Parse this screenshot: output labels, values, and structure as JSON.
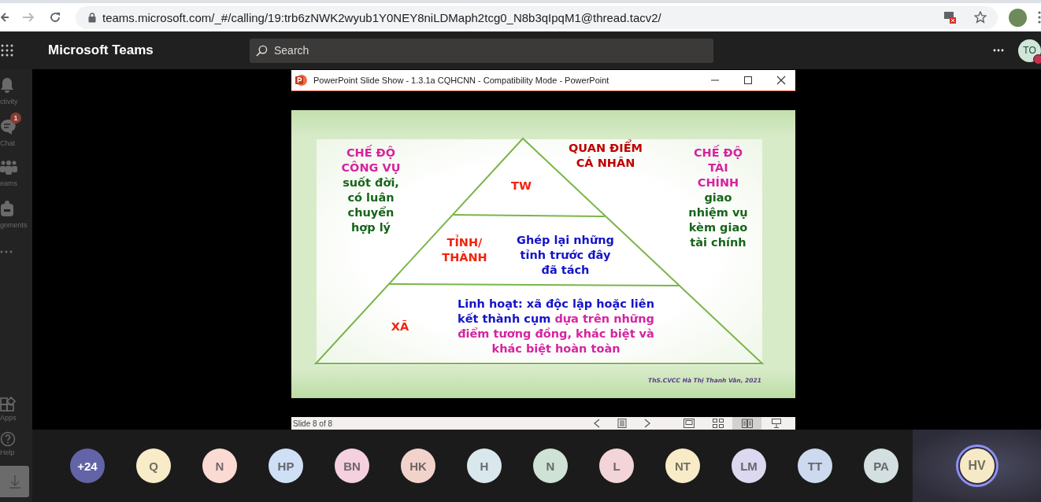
{
  "browser": {
    "url": "teams.microsoft.com/_#/calling/19:trb6zNWK2wyub1Y0NEY8niLDMaph2tcg0_N8b3qIpqM1@thread.tacv2/"
  },
  "app": {
    "title": "Microsoft Teams",
    "search_placeholder": "Search",
    "user_initials": "TO",
    "busy": true
  },
  "rail": {
    "top": [
      {
        "kind": "activity",
        "label": "ctivity"
      },
      {
        "kind": "chat",
        "label": "Chat",
        "badge": "1"
      },
      {
        "kind": "teams",
        "label": "eams"
      },
      {
        "kind": "assignments",
        "label": "gnments"
      },
      {
        "kind": "more"
      }
    ],
    "bottom": [
      {
        "kind": "apps",
        "label": "Apps"
      },
      {
        "kind": "help",
        "label": "Help"
      },
      {
        "kind": "download"
      }
    ]
  },
  "presentation": {
    "window_title": "PowerPoint Slide Show - 1.3.1a CQHCNN - Compatibility Mode - PowerPoint",
    "slide": {
      "left_box": {
        "heading": "CHẾ ĐỘ\nCÔNG VỤ",
        "body": "suốt đời,\ncó luân\nchuyển\nhợp lý"
      },
      "top_note": "QUAN ĐIỂM\nCÁ NHÂN",
      "right_box": {
        "heading": "CHẾ ĐỘ\nTÀI\nCHÍNH",
        "body": "giao\nnhiệm vụ\nkèm giao\ntài chính"
      },
      "levels": [
        {
          "label": "TW"
        },
        {
          "label": "TỈNH/\nTHÀNH",
          "description": [
            {
              "text": "Ghép lại những\ntỉnh trước đây\nđã tách",
              "emphasis": false
            }
          ]
        },
        {
          "label": "XÃ",
          "description": [
            {
              "text": "Linh hoạt: xã độc lập hoặc liên\nkết thành cụm ",
              "emphasis": false
            },
            {
              "text": "dựa trên những\nđiểm tương đồng, khác biệt và\nkhác biệt hoàn toàn",
              "emphasis": true
            }
          ]
        }
      ],
      "credit": "ThS.CVCC Hà Thị Thanh Vân, 2021"
    },
    "status": {
      "slide_counter": "Slide 8 of 8",
      "views": [
        {
          "kind": "normal",
          "selected": false
        },
        {
          "kind": "sorter",
          "selected": false
        },
        {
          "kind": "reading",
          "selected": true
        },
        {
          "kind": "slideshow",
          "selected": false
        }
      ]
    }
  },
  "participants": [
    {
      "kind": "overflow",
      "initials": "+24",
      "color": "#6264a7"
    },
    {
      "kind": "person",
      "initials": "Q",
      "color": "#f8ebc8"
    },
    {
      "kind": "person",
      "initials": "N",
      "color": "#fcdad4"
    },
    {
      "kind": "person",
      "initials": "HP",
      "color": "#cfdff5"
    },
    {
      "kind": "person",
      "initials": "BN",
      "color": "#f5d0de"
    },
    {
      "kind": "person",
      "initials": "HK",
      "color": "#f2d3cc"
    },
    {
      "kind": "person",
      "initials": "H",
      "color": "#d8e8ec"
    },
    {
      "kind": "person",
      "initials": "N",
      "color": "#cfe2d6"
    },
    {
      "kind": "person",
      "initials": "L",
      "color": "#f3d4d8"
    },
    {
      "kind": "person",
      "initials": "NT",
      "color": "#f8ebc8"
    },
    {
      "kind": "person",
      "initials": "LM",
      "color": "#dcd8ef"
    },
    {
      "kind": "person",
      "initials": "TT",
      "color": "#cdd9ee"
    },
    {
      "kind": "person",
      "initials": "PA",
      "color": "#d3dfe0"
    }
  ],
  "spotlight": {
    "initials": "HV",
    "color": "#f6e9c6",
    "speaking": true
  }
}
